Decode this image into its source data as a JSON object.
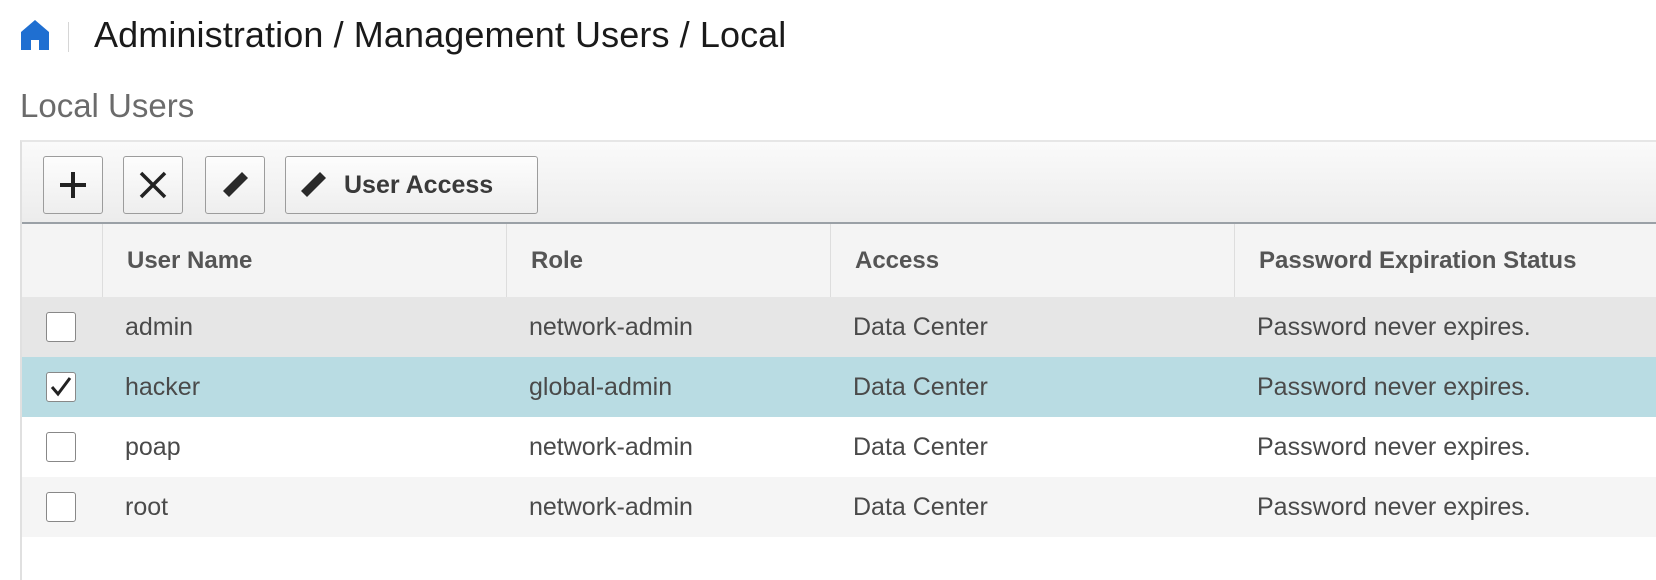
{
  "header": {
    "breadcrumb": "Administration / Management Users / Local",
    "home_icon": "home-icon"
  },
  "page": {
    "title": "Local Users"
  },
  "toolbar": {
    "add_icon": "plus-icon",
    "delete_icon": "close-icon",
    "edit_icon": "pencil-icon",
    "user_access_label": "User Access"
  },
  "table": {
    "columns": [
      "User Name",
      "Role",
      "Access",
      "Password Expiration Status"
    ],
    "rows": [
      {
        "checked": false,
        "user_name": "admin",
        "role": "network-admin",
        "access": "Data Center",
        "password_status": "Password never expires."
      },
      {
        "checked": true,
        "user_name": "hacker",
        "role": "global-admin",
        "access": "Data Center",
        "password_status": "Password never expires."
      },
      {
        "checked": false,
        "user_name": "poap",
        "role": "network-admin",
        "access": "Data Center",
        "password_status": "Password never expires."
      },
      {
        "checked": false,
        "user_name": "root",
        "role": "network-admin",
        "access": "Data Center",
        "password_status": "Password never expires."
      }
    ]
  },
  "colors": {
    "accent": "#1f6fd1",
    "selected_row": "#b9dce3",
    "row_odd": "#e6e6e6",
    "row_even_alt": "#f5f5f5"
  }
}
